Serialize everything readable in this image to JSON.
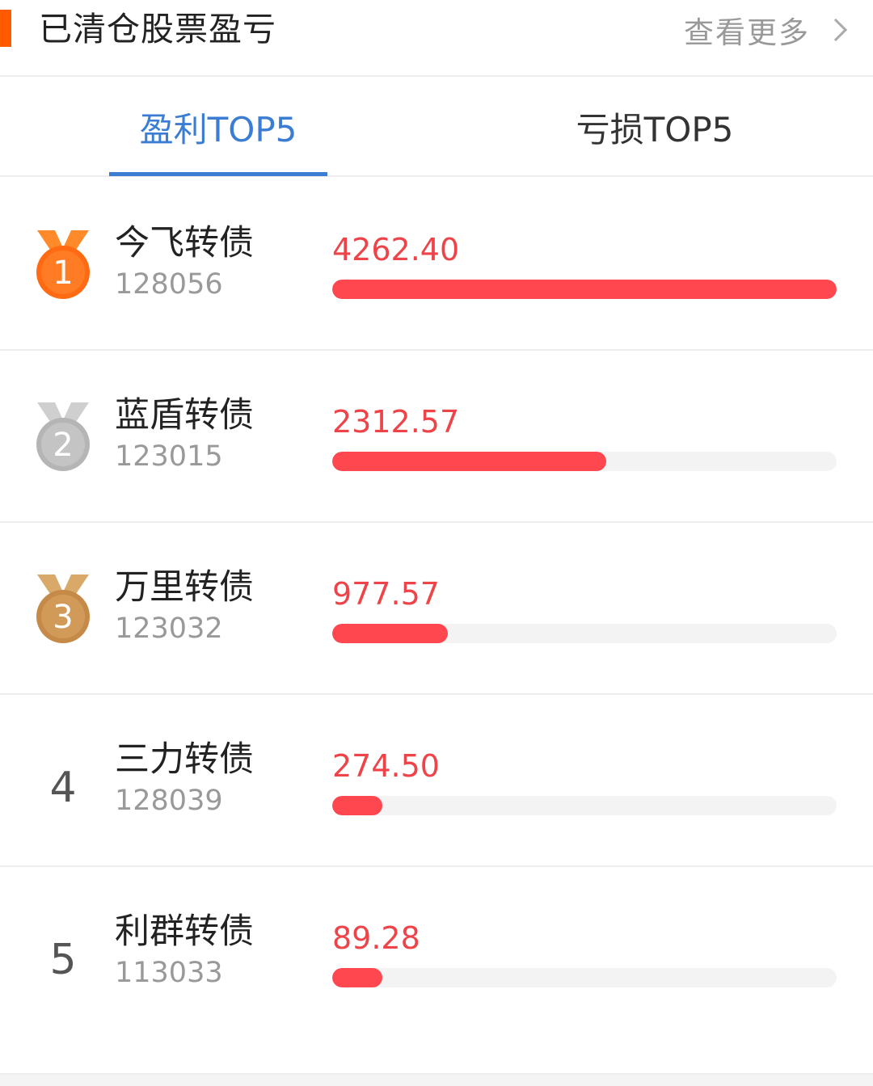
{
  "header": {
    "title": "已清仓股票盈亏",
    "more_label": "查看更多",
    "accent_color": "#ff5a00"
  },
  "tabs": [
    {
      "label": "盈利TOP5",
      "active": true
    },
    {
      "label": "亏损TOP5",
      "active": false
    }
  ],
  "colors": {
    "tab_active": "#3b7dd2",
    "value_text": "#ee4449",
    "bar_fill": "#ff474f",
    "bar_track": "#f3f3f3",
    "medal_gold": "#ff6a12",
    "medal_silver": "#bdbdbd",
    "medal_bronze": "#c98f4e"
  },
  "items": [
    {
      "rank": "1",
      "badge": "medal-gold",
      "name": "今飞转债",
      "code": "128056",
      "value": "4262.40",
      "bar_fraction": 1.0
    },
    {
      "rank": "2",
      "badge": "medal-silver",
      "name": "蓝盾转债",
      "code": "123015",
      "value": "2312.57",
      "bar_fraction": 0.5425
    },
    {
      "rank": "3",
      "badge": "medal-bronze",
      "name": "万里转债",
      "code": "123032",
      "value": "977.57",
      "bar_fraction": 0.2293
    },
    {
      "rank": "4",
      "badge": "none",
      "name": "三力转债",
      "code": "128039",
      "value": "274.50",
      "bar_fraction": 0.0644
    },
    {
      "rank": "5",
      "badge": "none",
      "name": "利群转债",
      "code": "113033",
      "value": "89.28",
      "bar_fraction": 0.0209
    }
  ]
}
